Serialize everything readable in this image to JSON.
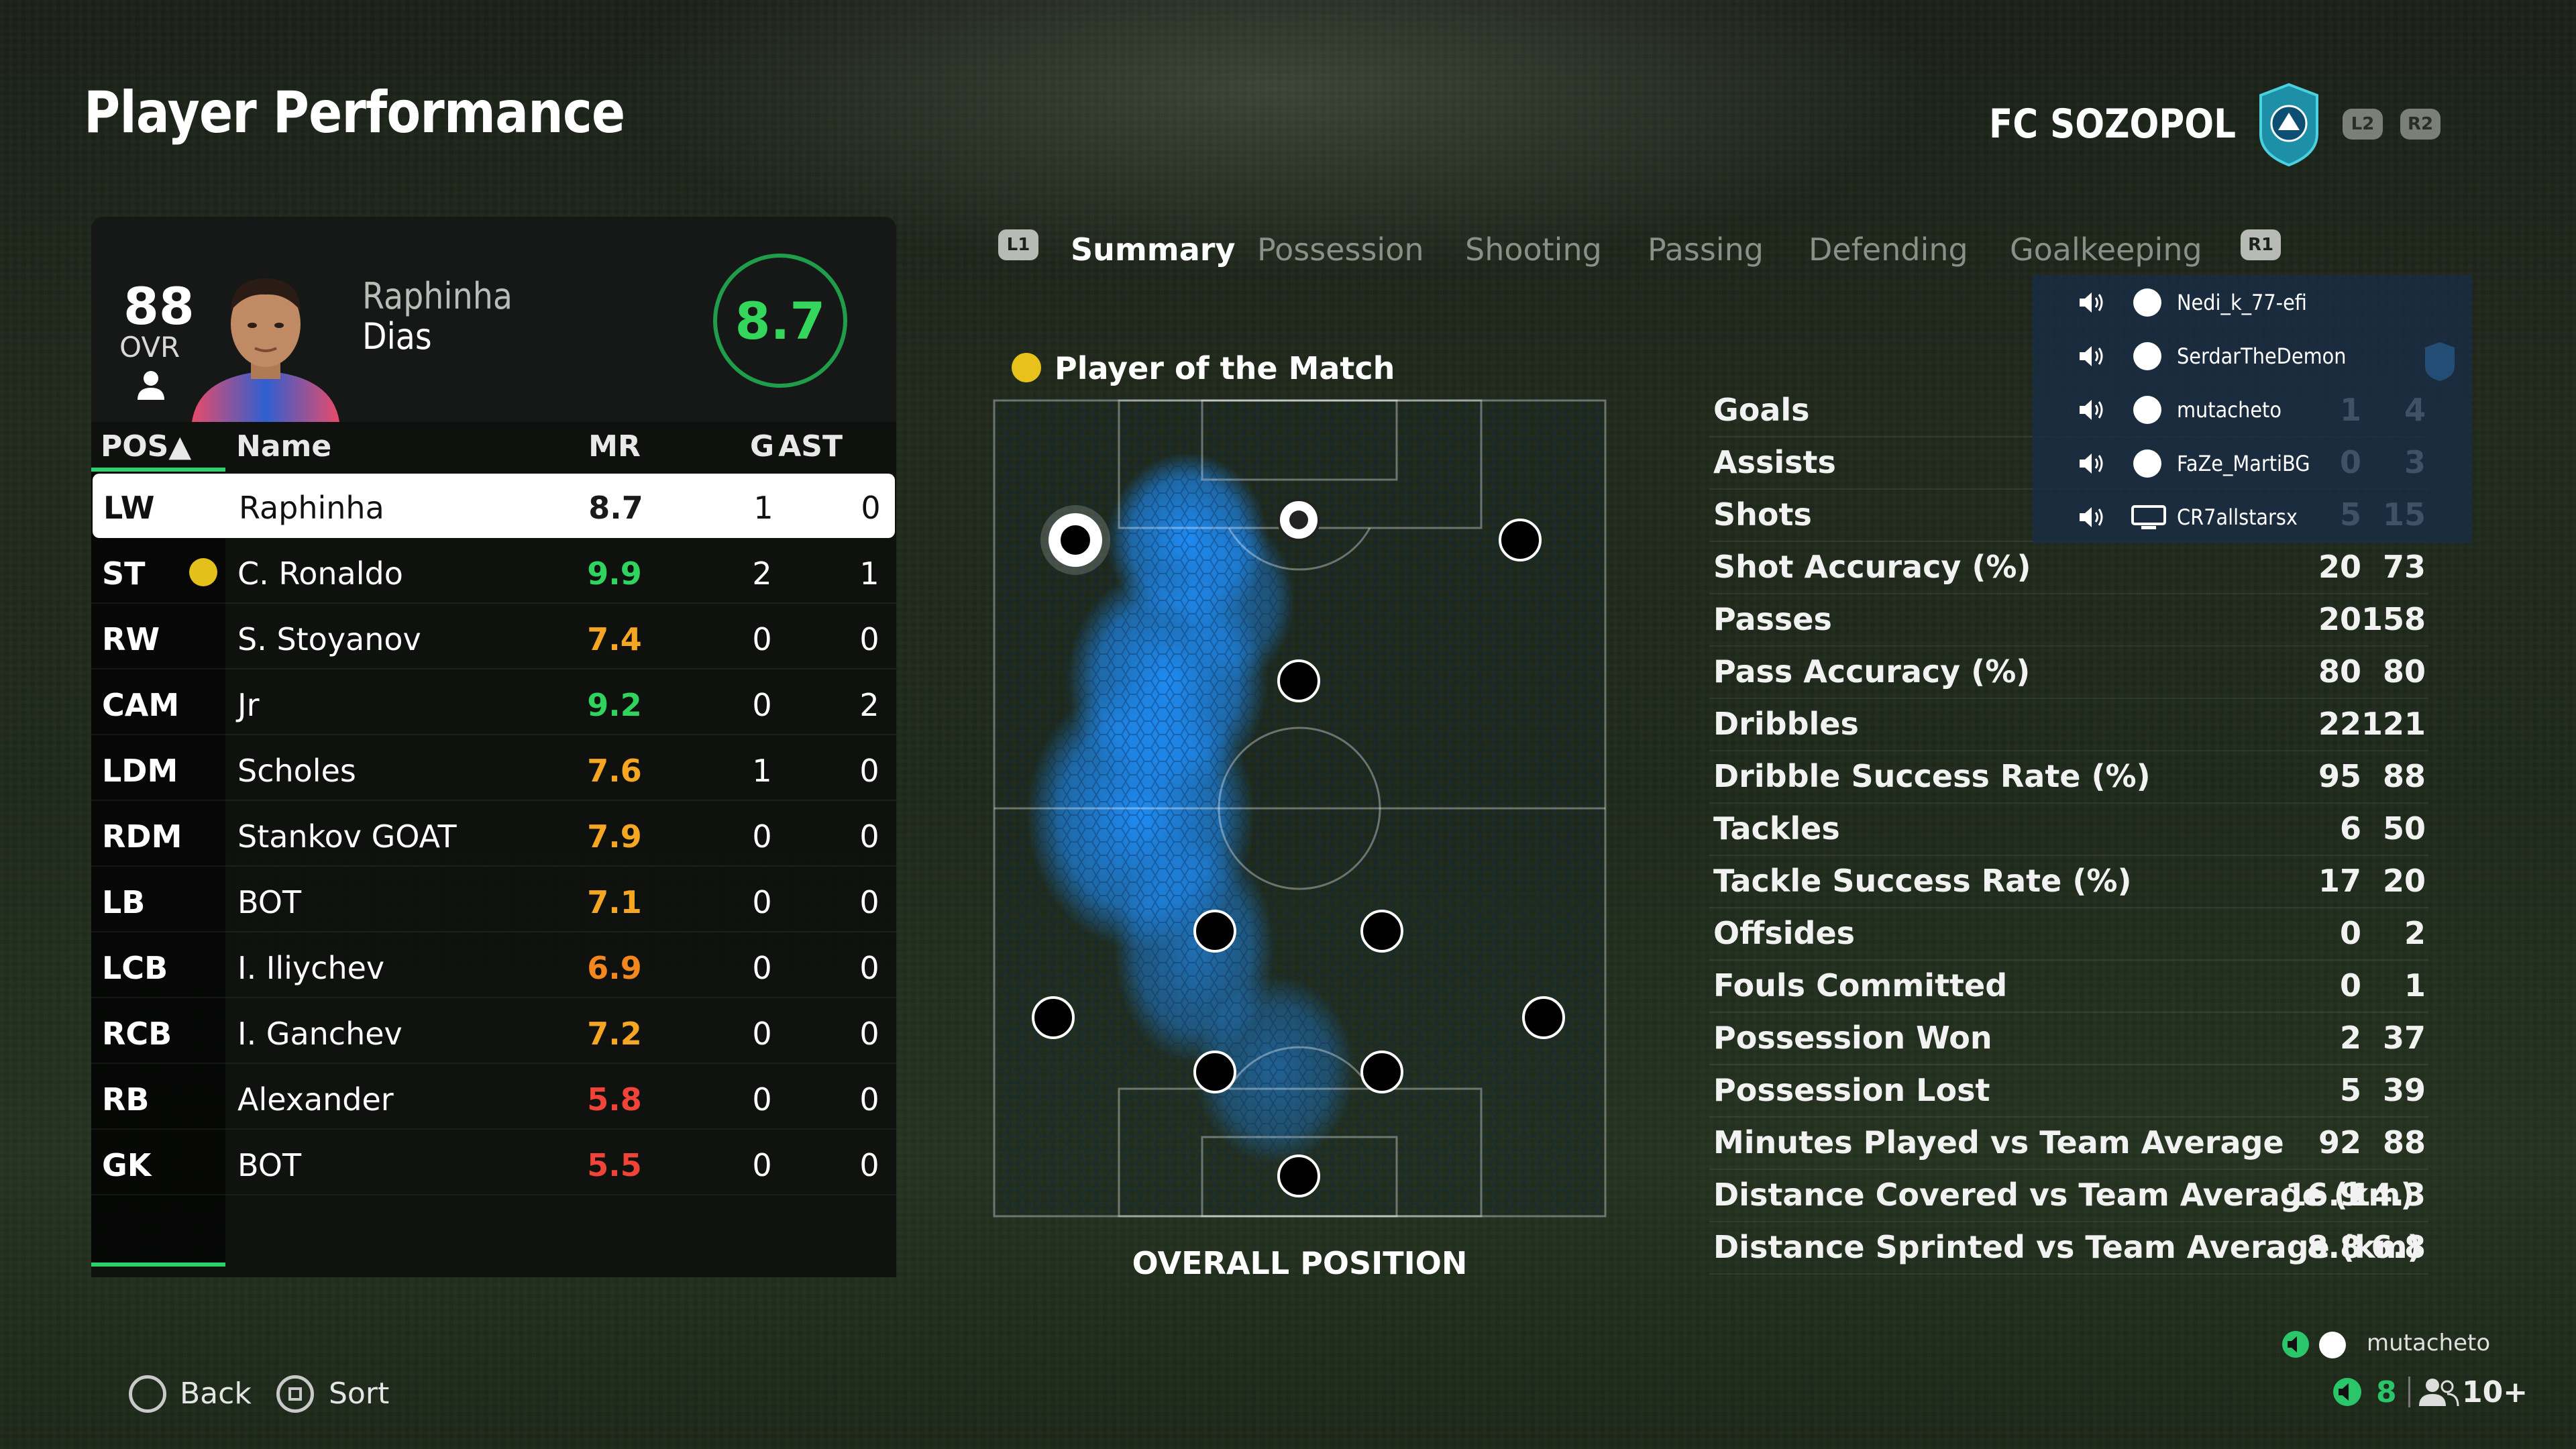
{
  "header": {
    "title": "Player Performance",
    "club": "FC SOZOPOL",
    "l2": "L2",
    "r2": "R2"
  },
  "player": {
    "ovr": "88",
    "ovr_label": "OVR",
    "first_name": "Raphinha",
    "last_name": "Dias",
    "match_rating": "8.7"
  },
  "table": {
    "headers": {
      "pos": "POS▲",
      "name": "Name",
      "mr": "MR",
      "g": "G",
      "ast": "AST"
    },
    "rows": [
      {
        "pos": "LW",
        "name": "Raphinha",
        "mr": "8.7",
        "g": "1",
        "ast": "0",
        "mr_color": "#1a1a1a",
        "selected": true
      },
      {
        "pos": "ST",
        "name": "C. Ronaldo",
        "mr": "9.9",
        "g": "2",
        "ast": "1",
        "mr_color": "#2fd35d",
        "potm": true
      },
      {
        "pos": "RW",
        "name": "S. Stoyanov",
        "mr": "7.4",
        "g": "0",
        "ast": "0",
        "mr_color": "#f5a623"
      },
      {
        "pos": "CAM",
        "name": "Jr",
        "mr": "9.2",
        "g": "0",
        "ast": "2",
        "mr_color": "#2fd35d"
      },
      {
        "pos": "LDM",
        "name": "Scholes",
        "mr": "7.6",
        "g": "1",
        "ast": "0",
        "mr_color": "#f5a623"
      },
      {
        "pos": "RDM",
        "name": "Stankov GOAT",
        "mr": "7.9",
        "g": "0",
        "ast": "0",
        "mr_color": "#f5a623"
      },
      {
        "pos": "LB",
        "name": "BOT",
        "mr": "7.1",
        "g": "0",
        "ast": "0",
        "mr_color": "#f5a623"
      },
      {
        "pos": "LCB",
        "name": "I. Iliychev",
        "mr": "6.9",
        "g": "0",
        "ast": "0",
        "mr_color": "#f5871f"
      },
      {
        "pos": "RCB",
        "name": "I. Ganchev",
        "mr": "7.2",
        "g": "0",
        "ast": "0",
        "mr_color": "#f5a623"
      },
      {
        "pos": "RB",
        "name": "Alexander",
        "mr": "5.8",
        "g": "0",
        "ast": "0",
        "mr_color": "#f04438"
      },
      {
        "pos": "GK",
        "name": "BOT",
        "mr": "5.5",
        "g": "0",
        "ast": "0",
        "mr_color": "#f04438"
      }
    ]
  },
  "tabs": {
    "l1": "L1",
    "r1": "R1",
    "items": [
      "Summary",
      "Possession",
      "Shooting",
      "Passing",
      "Defending",
      "Goalkeeping"
    ],
    "active": "Summary"
  },
  "pitch": {
    "potm_label": "Player of the Match",
    "caption": "OVERALL POSITION",
    "heat_color": "#1e90ff"
  },
  "stats": [
    {
      "label": "Goals",
      "a": "1",
      "b": "4"
    },
    {
      "label": "Assists",
      "a": "0",
      "b": "3"
    },
    {
      "label": "Shots",
      "a": "5",
      "b": "15"
    },
    {
      "label": "Shot Accuracy (%)",
      "a": "20",
      "b": "73"
    },
    {
      "label": "Passes",
      "a": "20",
      "b": "158"
    },
    {
      "label": "Pass Accuracy (%)",
      "a": "80",
      "b": "80"
    },
    {
      "label": "Dribbles",
      "a": "22",
      "b": "121"
    },
    {
      "label": "Dribble Success Rate (%)",
      "a": "95",
      "b": "88"
    },
    {
      "label": "Tackles",
      "a": "6",
      "b": "50"
    },
    {
      "label": "Tackle Success Rate (%)",
      "a": "17",
      "b": "20"
    },
    {
      "label": "Offsides",
      "a": "0",
      "b": "2"
    },
    {
      "label": "Fouls Committed",
      "a": "0",
      "b": "1"
    },
    {
      "label": "Possession Won",
      "a": "2",
      "b": "37"
    },
    {
      "label": "Possession Lost",
      "a": "5",
      "b": "39"
    },
    {
      "label": "Minutes Played vs Team Average",
      "a": "92",
      "b": "88"
    },
    {
      "label": "Distance Covered vs Team Average (km)",
      "a": "16.9",
      "b": "14.3"
    },
    {
      "label": "Distance Sprinted vs Team Average (km)",
      "a": "8.8",
      "b": "6.8"
    }
  ],
  "party": {
    "members": [
      {
        "name": "Nedi_k_77-efi",
        "platform": "ps"
      },
      {
        "name": "SerdarTheDemon",
        "platform": "ps"
      },
      {
        "name": "mutacheto",
        "platform": "ps"
      },
      {
        "name": "FaZe_MartiBG",
        "platform": "ps"
      },
      {
        "name": "CR7allstarsx",
        "platform": "pc"
      }
    ]
  },
  "footer": {
    "back": "Back",
    "sort": "Sort",
    "user": "mutacheto",
    "voice_count": "8",
    "friends_count": "10+"
  }
}
